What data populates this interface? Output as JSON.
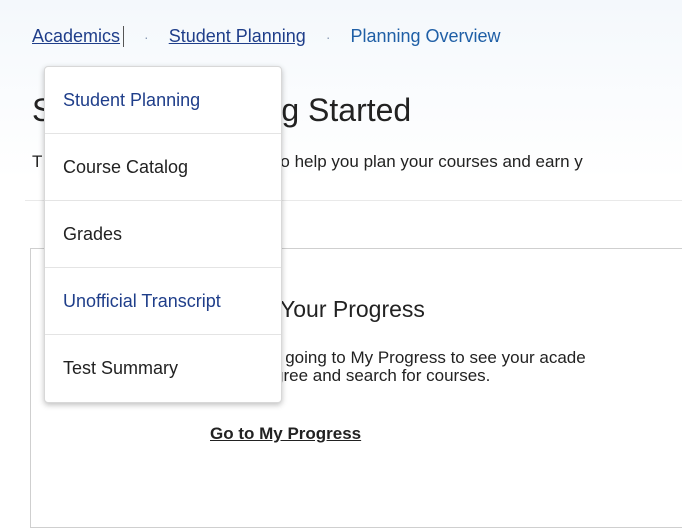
{
  "breadcrumb": {
    "items": [
      "Academics",
      "Student Planning",
      "Planning Overview"
    ],
    "separator": "·"
  },
  "page": {
    "title_visible_prefix": "S",
    "title_visible_suffix": "g Started",
    "intro_visible_prefix": "T",
    "intro_visible_suffix": "o help you plan your courses and earn y"
  },
  "card": {
    "title_visible": "Your Progress",
    "text_line1": "y going to My Progress to see your acade",
    "text_line2": "gree and search for courses.",
    "link_label": "Go to My Progress"
  },
  "menu": {
    "items": [
      {
        "label": "Student Planning",
        "style": "link"
      },
      {
        "label": "Course Catalog",
        "style": "normal"
      },
      {
        "label": "Grades",
        "style": "normal"
      },
      {
        "label": "Unofficial Transcript",
        "style": "link"
      },
      {
        "label": "Test Summary",
        "style": "normal"
      }
    ]
  },
  "colors": {
    "link": "#1f3e8a",
    "current_crumb": "#1f5fa6",
    "text": "#222222"
  }
}
